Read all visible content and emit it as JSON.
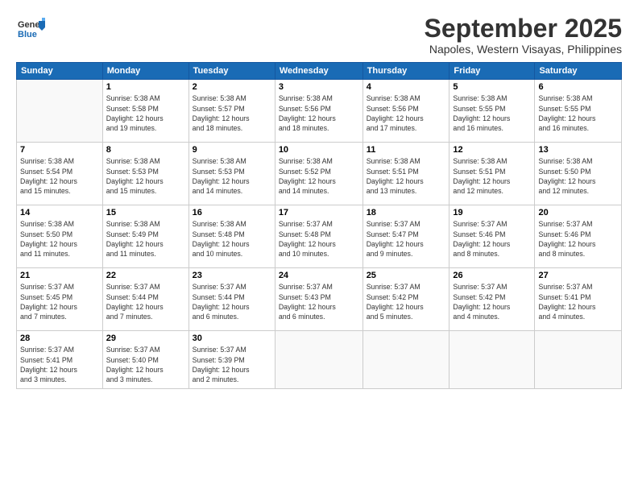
{
  "logo": {
    "line1": "General",
    "line2": "Blue"
  },
  "title": "September 2025",
  "subtitle": "Napoles, Western Visayas, Philippines",
  "days": [
    "Sunday",
    "Monday",
    "Tuesday",
    "Wednesday",
    "Thursday",
    "Friday",
    "Saturday"
  ],
  "weeks": [
    [
      {
        "num": "",
        "info": ""
      },
      {
        "num": "1",
        "info": "Sunrise: 5:38 AM\nSunset: 5:58 PM\nDaylight: 12 hours\nand 19 minutes."
      },
      {
        "num": "2",
        "info": "Sunrise: 5:38 AM\nSunset: 5:57 PM\nDaylight: 12 hours\nand 18 minutes."
      },
      {
        "num": "3",
        "info": "Sunrise: 5:38 AM\nSunset: 5:56 PM\nDaylight: 12 hours\nand 18 minutes."
      },
      {
        "num": "4",
        "info": "Sunrise: 5:38 AM\nSunset: 5:56 PM\nDaylight: 12 hours\nand 17 minutes."
      },
      {
        "num": "5",
        "info": "Sunrise: 5:38 AM\nSunset: 5:55 PM\nDaylight: 12 hours\nand 16 minutes."
      },
      {
        "num": "6",
        "info": "Sunrise: 5:38 AM\nSunset: 5:55 PM\nDaylight: 12 hours\nand 16 minutes."
      }
    ],
    [
      {
        "num": "7",
        "info": "Sunrise: 5:38 AM\nSunset: 5:54 PM\nDaylight: 12 hours\nand 15 minutes."
      },
      {
        "num": "8",
        "info": "Sunrise: 5:38 AM\nSunset: 5:53 PM\nDaylight: 12 hours\nand 15 minutes."
      },
      {
        "num": "9",
        "info": "Sunrise: 5:38 AM\nSunset: 5:53 PM\nDaylight: 12 hours\nand 14 minutes."
      },
      {
        "num": "10",
        "info": "Sunrise: 5:38 AM\nSunset: 5:52 PM\nDaylight: 12 hours\nand 14 minutes."
      },
      {
        "num": "11",
        "info": "Sunrise: 5:38 AM\nSunset: 5:51 PM\nDaylight: 12 hours\nand 13 minutes."
      },
      {
        "num": "12",
        "info": "Sunrise: 5:38 AM\nSunset: 5:51 PM\nDaylight: 12 hours\nand 12 minutes."
      },
      {
        "num": "13",
        "info": "Sunrise: 5:38 AM\nSunset: 5:50 PM\nDaylight: 12 hours\nand 12 minutes."
      }
    ],
    [
      {
        "num": "14",
        "info": "Sunrise: 5:38 AM\nSunset: 5:50 PM\nDaylight: 12 hours\nand 11 minutes."
      },
      {
        "num": "15",
        "info": "Sunrise: 5:38 AM\nSunset: 5:49 PM\nDaylight: 12 hours\nand 11 minutes."
      },
      {
        "num": "16",
        "info": "Sunrise: 5:38 AM\nSunset: 5:48 PM\nDaylight: 12 hours\nand 10 minutes."
      },
      {
        "num": "17",
        "info": "Sunrise: 5:37 AM\nSunset: 5:48 PM\nDaylight: 12 hours\nand 10 minutes."
      },
      {
        "num": "18",
        "info": "Sunrise: 5:37 AM\nSunset: 5:47 PM\nDaylight: 12 hours\nand 9 minutes."
      },
      {
        "num": "19",
        "info": "Sunrise: 5:37 AM\nSunset: 5:46 PM\nDaylight: 12 hours\nand 8 minutes."
      },
      {
        "num": "20",
        "info": "Sunrise: 5:37 AM\nSunset: 5:46 PM\nDaylight: 12 hours\nand 8 minutes."
      }
    ],
    [
      {
        "num": "21",
        "info": "Sunrise: 5:37 AM\nSunset: 5:45 PM\nDaylight: 12 hours\nand 7 minutes."
      },
      {
        "num": "22",
        "info": "Sunrise: 5:37 AM\nSunset: 5:44 PM\nDaylight: 12 hours\nand 7 minutes."
      },
      {
        "num": "23",
        "info": "Sunrise: 5:37 AM\nSunset: 5:44 PM\nDaylight: 12 hours\nand 6 minutes."
      },
      {
        "num": "24",
        "info": "Sunrise: 5:37 AM\nSunset: 5:43 PM\nDaylight: 12 hours\nand 6 minutes."
      },
      {
        "num": "25",
        "info": "Sunrise: 5:37 AM\nSunset: 5:42 PM\nDaylight: 12 hours\nand 5 minutes."
      },
      {
        "num": "26",
        "info": "Sunrise: 5:37 AM\nSunset: 5:42 PM\nDaylight: 12 hours\nand 4 minutes."
      },
      {
        "num": "27",
        "info": "Sunrise: 5:37 AM\nSunset: 5:41 PM\nDaylight: 12 hours\nand 4 minutes."
      }
    ],
    [
      {
        "num": "28",
        "info": "Sunrise: 5:37 AM\nSunset: 5:41 PM\nDaylight: 12 hours\nand 3 minutes."
      },
      {
        "num": "29",
        "info": "Sunrise: 5:37 AM\nSunset: 5:40 PM\nDaylight: 12 hours\nand 3 minutes."
      },
      {
        "num": "30",
        "info": "Sunrise: 5:37 AM\nSunset: 5:39 PM\nDaylight: 12 hours\nand 2 minutes."
      },
      {
        "num": "",
        "info": ""
      },
      {
        "num": "",
        "info": ""
      },
      {
        "num": "",
        "info": ""
      },
      {
        "num": "",
        "info": ""
      }
    ]
  ]
}
